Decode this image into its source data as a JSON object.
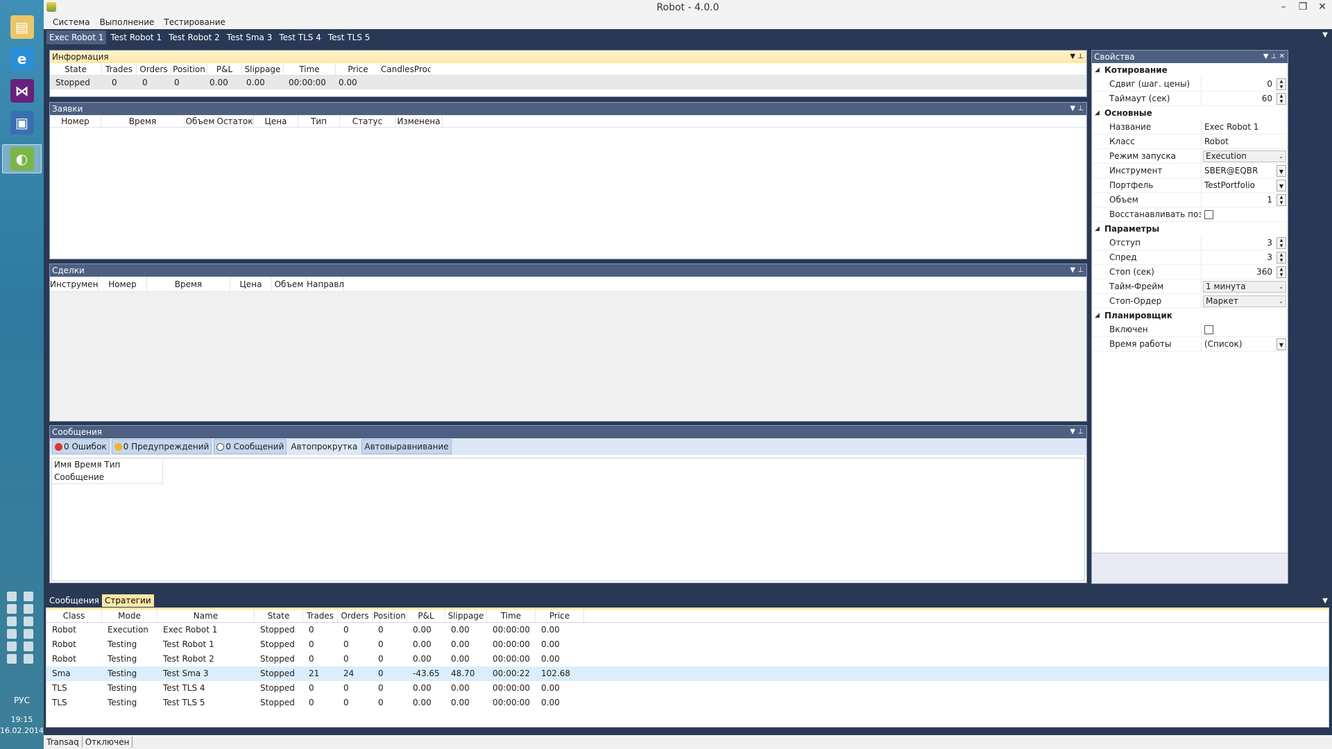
{
  "window": {
    "title": "Robot - 4.0.0"
  },
  "datetime": {
    "time": "19:15",
    "date": "16.02.2014"
  },
  "language": "РУС",
  "menu": [
    "Система",
    "Выполнение",
    "Тестирование"
  ],
  "tabs": [
    {
      "label": "Exec Robot 1",
      "active": true
    },
    {
      "label": "Test Robot 1"
    },
    {
      "label": "Test Robot 2"
    },
    {
      "label": "Test Sma 3"
    },
    {
      "label": "Test TLS 4"
    },
    {
      "label": "Test TLS 5"
    }
  ],
  "info_panel": {
    "title": "Информация",
    "columns": [
      "State",
      "Trades",
      "Orders",
      "Position",
      "P&L",
      "Slippage",
      "Time",
      "Price",
      "CandlesProc"
    ],
    "row": [
      "Stopped",
      "0",
      "0",
      "0",
      "0.00",
      "0.00",
      "00:00:00",
      "0.00",
      ""
    ]
  },
  "orders_panel": {
    "title": "Заявки",
    "columns": [
      "Номер",
      "Время",
      "Объем",
      "Остаток",
      "Цена",
      "Тип",
      "Статус",
      "Изменена"
    ]
  },
  "trades_panel": {
    "title": "Сделки",
    "columns": [
      "Инструмен",
      "Номер",
      "Время",
      "Цена",
      "Объем",
      "Направл"
    ]
  },
  "messages_panel": {
    "title": "Сообщения",
    "errors": "0 Ошибок",
    "warnings": "0 Предупреждений",
    "infos": "0 Сообщений",
    "autoscroll": "Автопрокрутка",
    "autoalign": "Автовыравнивание",
    "columns": "Имя Время Тип Сообщение"
  },
  "properties": {
    "title": "Свойства",
    "categories": [
      {
        "name": "Котирование",
        "rows": [
          {
            "name": "Сдвиг (шаг. цены)",
            "value": "0",
            "kind": "spin"
          },
          {
            "name": "Таймаут (сек)",
            "value": "60",
            "kind": "spin"
          }
        ]
      },
      {
        "name": "Основные",
        "rows": [
          {
            "name": "Название",
            "value": "Exec Robot 1",
            "kind": "text"
          },
          {
            "name": "Класс",
            "value": "Robot",
            "kind": "text"
          },
          {
            "name": "Режим запуска",
            "value": "Execution",
            "kind": "combo"
          },
          {
            "name": "Инструмент",
            "value": "SBER@EQBR",
            "kind": "dropdown"
          },
          {
            "name": "Портфель",
            "value": "TestPortfolio",
            "kind": "dropdown"
          },
          {
            "name": "Объем",
            "value": "1",
            "kind": "spin"
          },
          {
            "name": "Восстанавливать поз...",
            "value": "",
            "kind": "check"
          }
        ]
      },
      {
        "name": "Параметры",
        "rows": [
          {
            "name": "Отступ",
            "value": "3",
            "kind": "spin"
          },
          {
            "name": "Спред",
            "value": "3",
            "kind": "spin"
          },
          {
            "name": "Стоп (сек)",
            "value": "360",
            "kind": "spin"
          },
          {
            "name": "Тайм-Фрейм",
            "value": "1 минута",
            "kind": "combo"
          },
          {
            "name": "Стоп-Ордер",
            "value": "Маркет",
            "kind": "combo"
          }
        ]
      },
      {
        "name": "Планировщик",
        "rows": [
          {
            "name": "Включен",
            "value": "",
            "kind": "check"
          },
          {
            "name": "Время работы",
            "value": "(Список)",
            "kind": "dropdown"
          }
        ]
      }
    ]
  },
  "bottom_tabs": [
    {
      "label": "Сообщения"
    },
    {
      "label": "Стратегии",
      "active": true
    }
  ],
  "strategies": {
    "columns": [
      "Class",
      "Mode",
      "Name",
      "State",
      "Trades",
      "Orders",
      "Position",
      "P&L",
      "Slippage",
      "Time",
      "Price"
    ],
    "rows": [
      [
        "Robot",
        "Execution",
        "Exec Robot 1",
        "Stopped",
        "0",
        "0",
        "0",
        "0.00",
        "0.00",
        "00:00:00",
        "0.00"
      ],
      [
        "Robot",
        "Testing",
        "Test Robot 1",
        "Stopped",
        "0",
        "0",
        "0",
        "0.00",
        "0.00",
        "00:00:00",
        "0.00"
      ],
      [
        "Robot",
        "Testing",
        "Test Robot 2",
        "Stopped",
        "0",
        "0",
        "0",
        "0.00",
        "0.00",
        "00:00:00",
        "0.00"
      ],
      [
        "Sma",
        "Testing",
        "Test Sma 3",
        "Stopped",
        "21",
        "24",
        "0",
        "-43.65",
        "48.70",
        "00:00:22",
        "102.68"
      ],
      [
        "TLS",
        "Testing",
        "Test TLS 4",
        "Stopped",
        "0",
        "0",
        "0",
        "0.00",
        "0.00",
        "00:00:00",
        "0.00"
      ],
      [
        "TLS",
        "Testing",
        "Test TLS 5",
        "Stopped",
        "0",
        "0",
        "0",
        "0.00",
        "0.00",
        "00:00:00",
        "0.00"
      ]
    ],
    "selected_row": 3
  },
  "statusbar": [
    "Transaq",
    "Отключен"
  ]
}
